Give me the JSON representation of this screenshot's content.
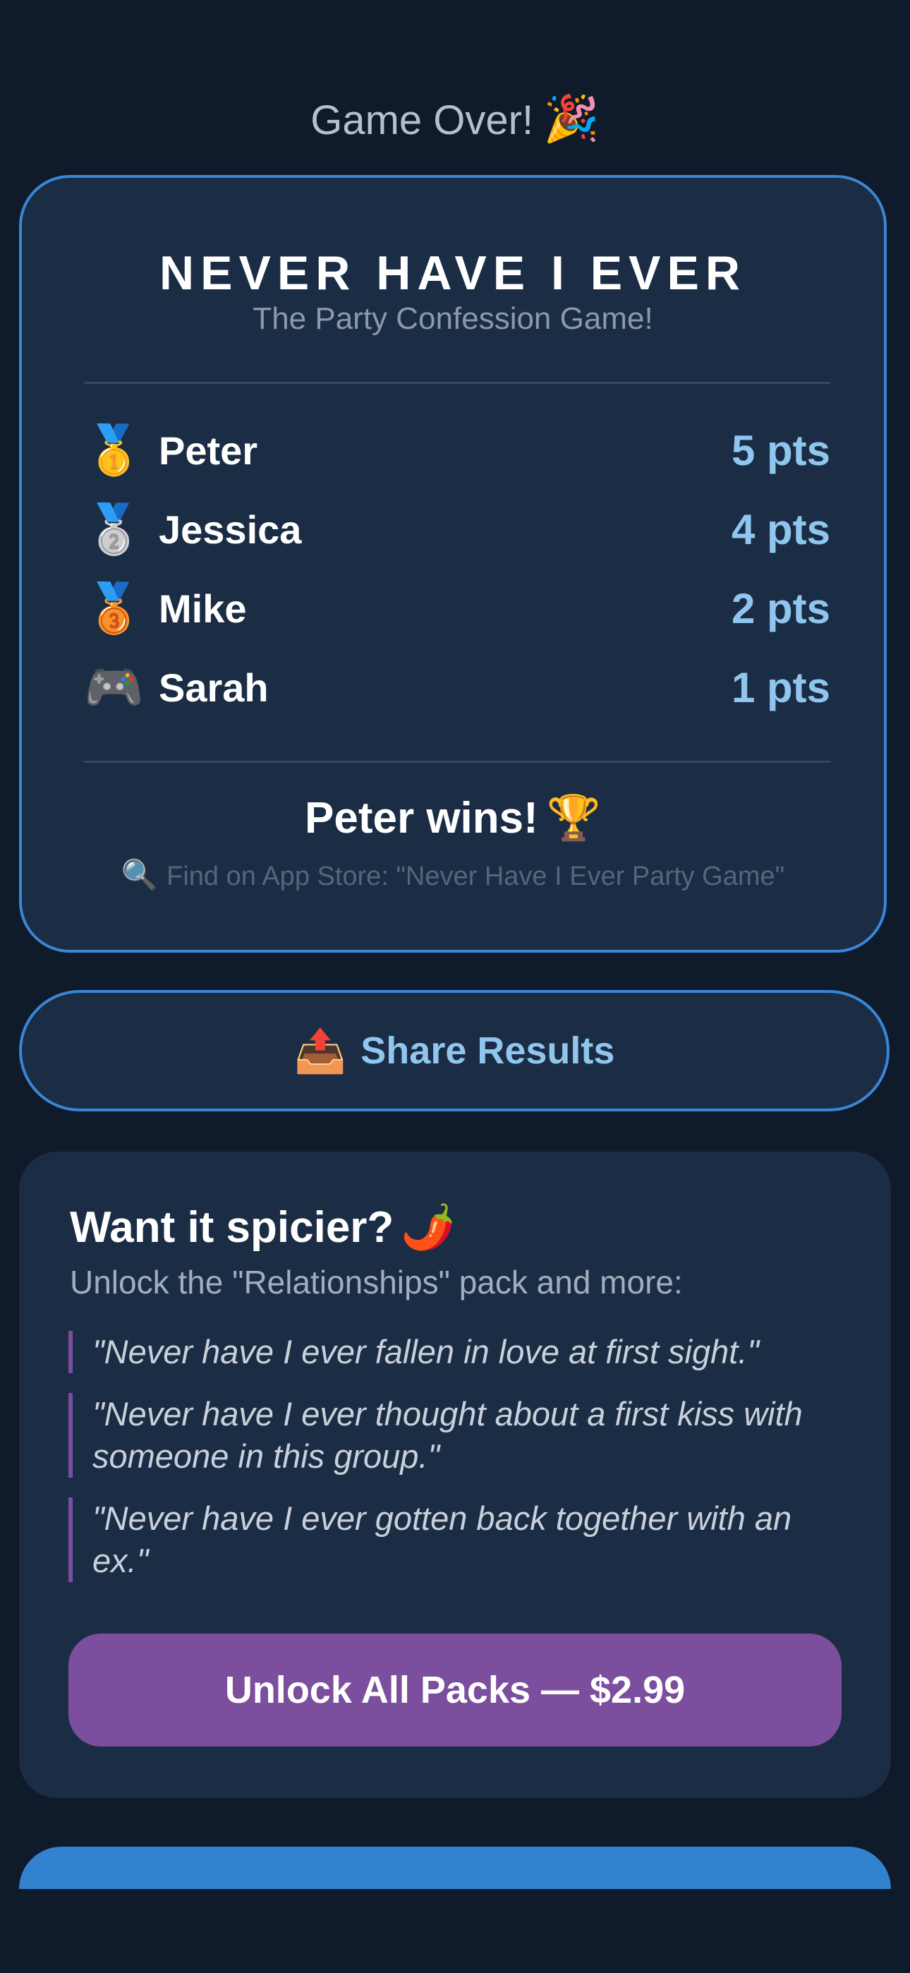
{
  "header": {
    "title": "Game Over!",
    "title_icon": "party-popper-icon",
    "title_emoji": "🎉"
  },
  "result_card": {
    "game_title": "NEVER HAVE I EVER",
    "game_subtitle": "The Party Confession Game!",
    "scores": [
      {
        "icon": "gold-medal-icon",
        "emoji": "🥇",
        "name": "Peter",
        "points": "5 pts"
      },
      {
        "icon": "silver-medal-icon",
        "emoji": "🥈",
        "name": "Jessica",
        "points": "4 pts"
      },
      {
        "icon": "bronze-medal-icon",
        "emoji": "🥉",
        "name": "Mike",
        "points": "2 pts"
      },
      {
        "icon": "game-controller-icon",
        "emoji": "🎮",
        "name": "Sarah",
        "points": "1 pts"
      }
    ],
    "winner_text": "Peter wins!",
    "winner_icon": "trophy-icon",
    "winner_emoji": "🏆",
    "store_hint_icon": "magnifier-icon",
    "store_hint_emoji": "🔍",
    "store_hint": "Find on App Store: \"Never Have I Ever Party Game\""
  },
  "share": {
    "label": "Share Results",
    "icon": "outbox-tray-icon",
    "emoji": "📤"
  },
  "upsell": {
    "title": "Want it spicier?",
    "title_icon": "chili-pepper-icon",
    "title_emoji": "🌶️",
    "subtitle": "Unlock the \"Relationships\" pack and more:",
    "quotes": [
      "\"Never have I ever fallen in love at first sight.\"",
      "\"Never have I ever thought about a first kiss with someone in this group.\"",
      "\"Never have I ever gotten back together with an ex.\""
    ],
    "unlock_label": "Unlock All Packs — $2.99"
  },
  "colors": {
    "background": "#0f1a2b",
    "card": "#1b2d45",
    "accent_blue": "#3a86d6",
    "points": "#90c6ee",
    "unlock_purple": "#7c4f9e"
  }
}
